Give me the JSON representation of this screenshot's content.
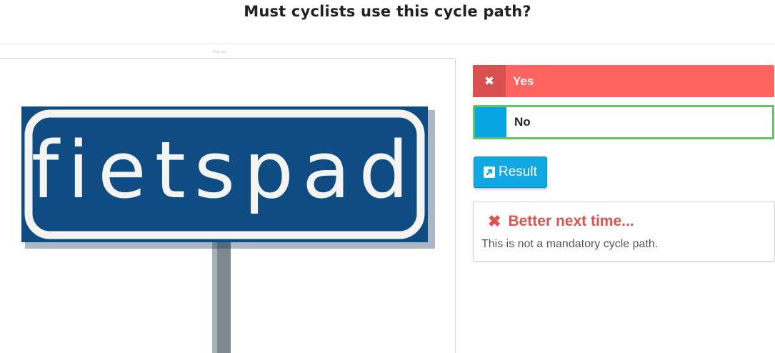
{
  "question": {
    "title": "Must cyclists use this cycle path?",
    "image_caption": "[foto ab]",
    "sign_text": "fietspad"
  },
  "answers": [
    {
      "label": "Yes",
      "state": "selected-wrong",
      "marker_icon": "close-icon",
      "color": "#ff6461"
    },
    {
      "label": "No",
      "state": "correct",
      "marker_color": "#08a5e3",
      "border_color": "#62c462"
    }
  ],
  "result_button": {
    "label": "Result",
    "icon": "external-link-icon",
    "color": "#10a8e2"
  },
  "feedback": {
    "icon": "close-icon",
    "heading": "Better next time...",
    "text": "This is not a mandatory cycle path.",
    "color": "#d9534f"
  },
  "colors": {
    "sign_blue": "#104c84",
    "sign_white": "#f4f4f2"
  }
}
